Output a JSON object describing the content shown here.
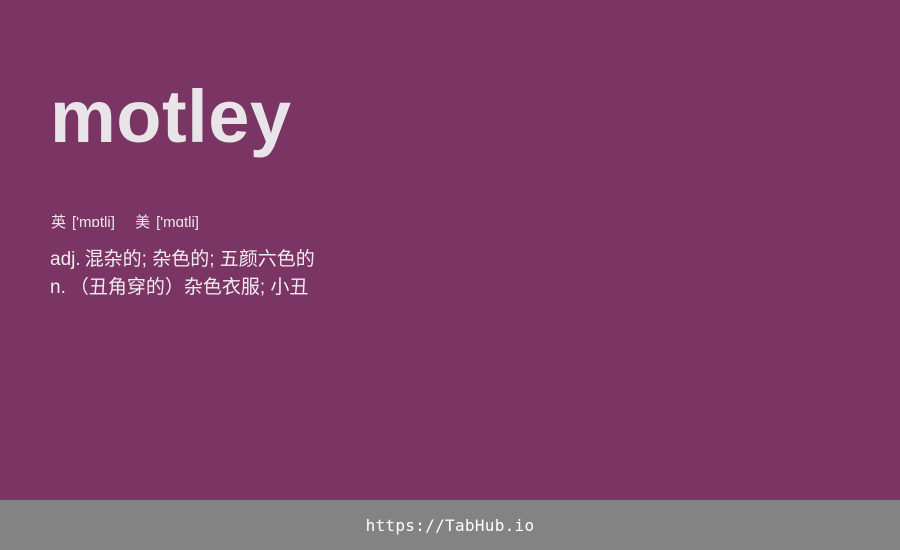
{
  "word": "motley",
  "phonetics": [
    {
      "region": "英",
      "ipa": "['mɒtli]"
    },
    {
      "region": "美",
      "ipa": "['mɑtli]"
    }
  ],
  "definitions": [
    {
      "pos": "adj.",
      "meaning": "混杂的; 杂色的; 五颜六色的"
    },
    {
      "pos": "n.",
      "meaning": "（丑角穿的）杂色衣服; 小丑"
    }
  ],
  "footer": {
    "url": "https://TabHub.io"
  },
  "colors": {
    "background": "#7b3565",
    "footer_background": "#838383",
    "text": "#e8e4e8"
  }
}
